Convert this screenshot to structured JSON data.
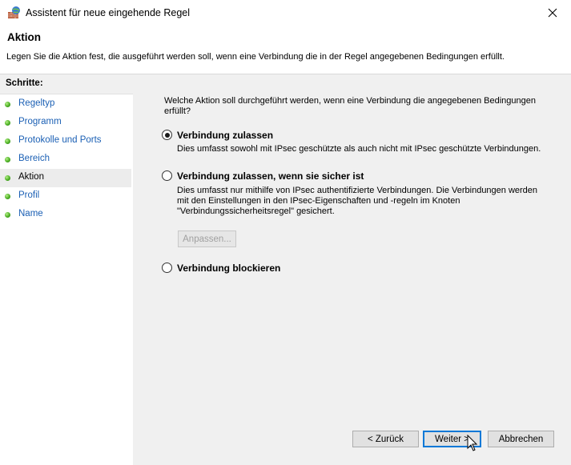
{
  "window": {
    "title": "Assistent für neue eingehende Regel",
    "icon": "firewall-icon",
    "close_icon": "close-icon"
  },
  "header": {
    "title": "Aktion",
    "description": "Legen Sie die Aktion fest, die ausgeführt werden soll, wenn eine Verbindung die in der Regel angegebenen Bedingungen erfüllt."
  },
  "sidebar": {
    "heading": "Schritte:",
    "items": [
      {
        "label": "Regeltyp"
      },
      {
        "label": "Programm"
      },
      {
        "label": "Protokolle und Ports"
      },
      {
        "label": "Bereich"
      },
      {
        "label": "Aktion",
        "active": true
      },
      {
        "label": "Profil"
      },
      {
        "label": "Name"
      }
    ]
  },
  "main": {
    "question_line1": "Welche Aktion soll durchgeführt werden, wenn eine Verbindung die angegebenen Bedingungen",
    "question_line2": "erfüllt?",
    "options": [
      {
        "label": "Verbindung zulassen",
        "checked": true,
        "desc_lines": [
          "Dies umfasst sowohl mit IPsec geschützte als auch nicht mit IPsec geschützte Verbindungen."
        ]
      },
      {
        "label": "Verbindung zulassen, wenn sie sicher ist",
        "checked": false,
        "desc_lines": [
          "Dies umfasst nur mithilfe von IPsec authentifizierte Verbindungen. Die Verbindungen werden",
          "mit den Einstellungen in den IPsec-Eigenschaften und -regeln im Knoten",
          "\"Verbindungssicherheitsregel\" gesichert."
        ]
      },
      {
        "label": "Verbindung blockieren",
        "checked": false,
        "desc_lines": []
      }
    ],
    "customize_button": "Anpassen..."
  },
  "footer": {
    "back": "< Zurück",
    "next": "Weiter >",
    "cancel": "Abbrechen"
  }
}
